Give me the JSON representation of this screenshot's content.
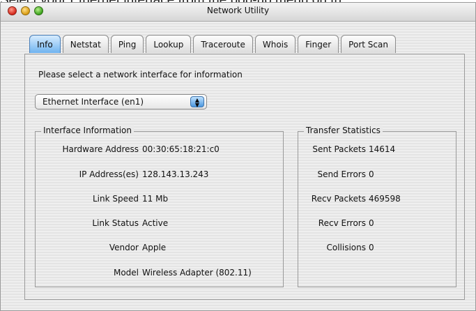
{
  "caption": "Select your Ethernet interface from the pop-up menu on th",
  "window": {
    "title": "Network Utility"
  },
  "tabs": [
    {
      "label": "Info",
      "active": true
    },
    {
      "label": "Netstat"
    },
    {
      "label": "Ping"
    },
    {
      "label": "Lookup"
    },
    {
      "label": "Traceroute"
    },
    {
      "label": "Whois"
    },
    {
      "label": "Finger"
    },
    {
      "label": "Port Scan"
    }
  ],
  "prompt": "Please select a network interface for information",
  "interface_select": {
    "value": "Ethernet Interface (en1)"
  },
  "interface_info": {
    "legend": "Interface Information",
    "rows": [
      {
        "label": "Hardware Address",
        "value": "00:30:65:18:21:c0"
      },
      {
        "label": "IP Address(es)",
        "value": "128.143.13.243"
      },
      {
        "label": "Link Speed",
        "value": "11 Mb"
      },
      {
        "label": "Link Status",
        "value": "Active"
      },
      {
        "label": "Vendor",
        "value": "Apple"
      },
      {
        "label": "Model",
        "value": "Wireless Adapter (802.11)"
      }
    ]
  },
  "transfer_stats": {
    "legend": "Transfer Statistics",
    "rows": [
      {
        "label": "Sent Packets",
        "value": "14614"
      },
      {
        "label": "Send Errors",
        "value": "0"
      },
      {
        "label": "Recv Packets",
        "value": "469598"
      },
      {
        "label": "Recv Errors",
        "value": "0"
      },
      {
        "label": "Collisions",
        "value": "0"
      }
    ]
  },
  "colors": {
    "active_tab": "#6fb3ef",
    "close": "#d3261a",
    "minimize": "#d89a10",
    "zoom": "#3aa11c"
  }
}
